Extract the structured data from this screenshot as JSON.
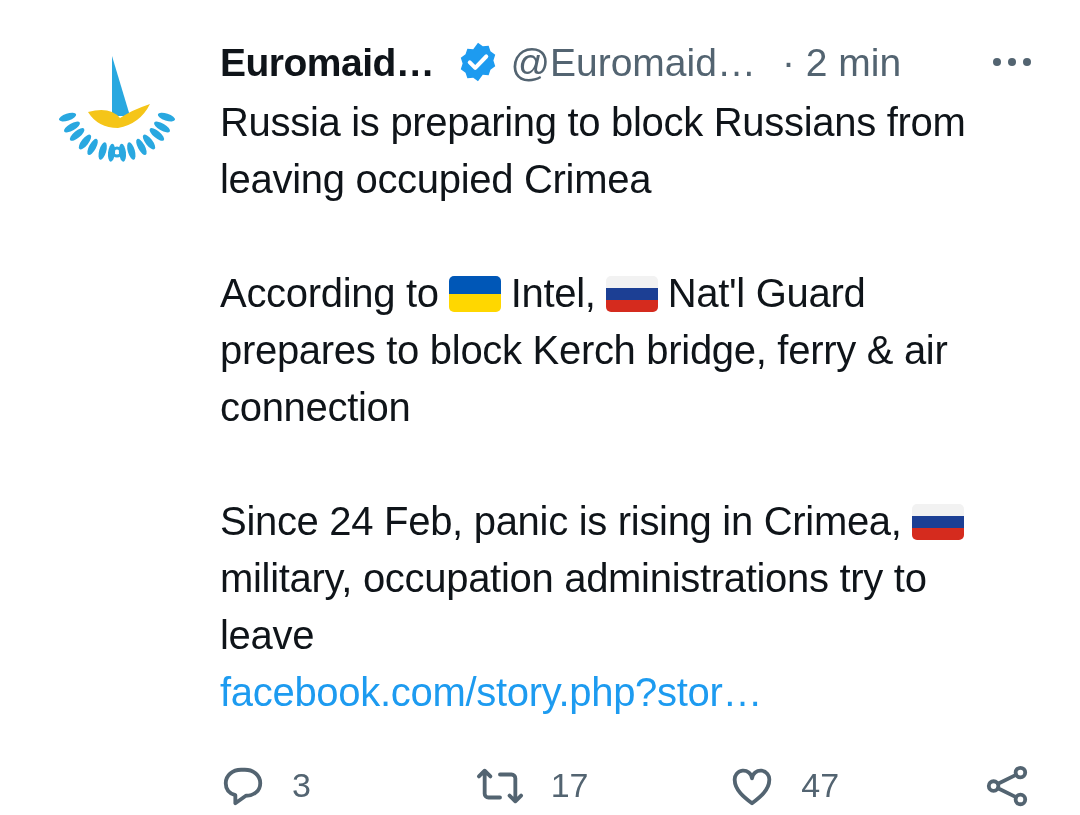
{
  "tweet": {
    "author": {
      "name": "Euromaid…",
      "verified": true,
      "handle": "@Euromaid…",
      "time": "· 2 min"
    },
    "paragraphs": [
      [
        [
          {
            "kind": "text",
            "text": "Russia is preparing to block Russians from"
          }
        ],
        [
          {
            "kind": "text",
            "text": "leaving occupied Crimea"
          }
        ]
      ],
      [
        [
          {
            "kind": "text",
            "text": "According to"
          },
          {
            "kind": "flag_ua"
          },
          {
            "kind": "text",
            "text": "Intel,"
          },
          {
            "kind": "flag_ru"
          },
          {
            "kind": "text",
            "text": "Nat'l Guard"
          }
        ],
        [
          {
            "kind": "text",
            "text": "prepares to block Kerch bridge, ferry & air"
          }
        ],
        [
          {
            "kind": "text",
            "text": "connection"
          }
        ]
      ],
      [
        [
          {
            "kind": "text",
            "text": "Since 24 Feb, panic is rising in Crimea,"
          },
          {
            "kind": "flag_ru"
          }
        ],
        [
          {
            "kind": "text",
            "text": "military, occupation administrations try to"
          }
        ],
        [
          {
            "kind": "text",
            "text": "leave"
          }
        ],
        [
          {
            "kind": "link",
            "text": "facebook.com/story.php?stor…"
          }
        ]
      ]
    ],
    "actions": [
      {
        "kind": "reply",
        "count": "3"
      },
      {
        "kind": "retweet",
        "count": "17"
      },
      {
        "kind": "like",
        "count": "47"
      },
      {
        "kind": "share"
      }
    ]
  }
}
